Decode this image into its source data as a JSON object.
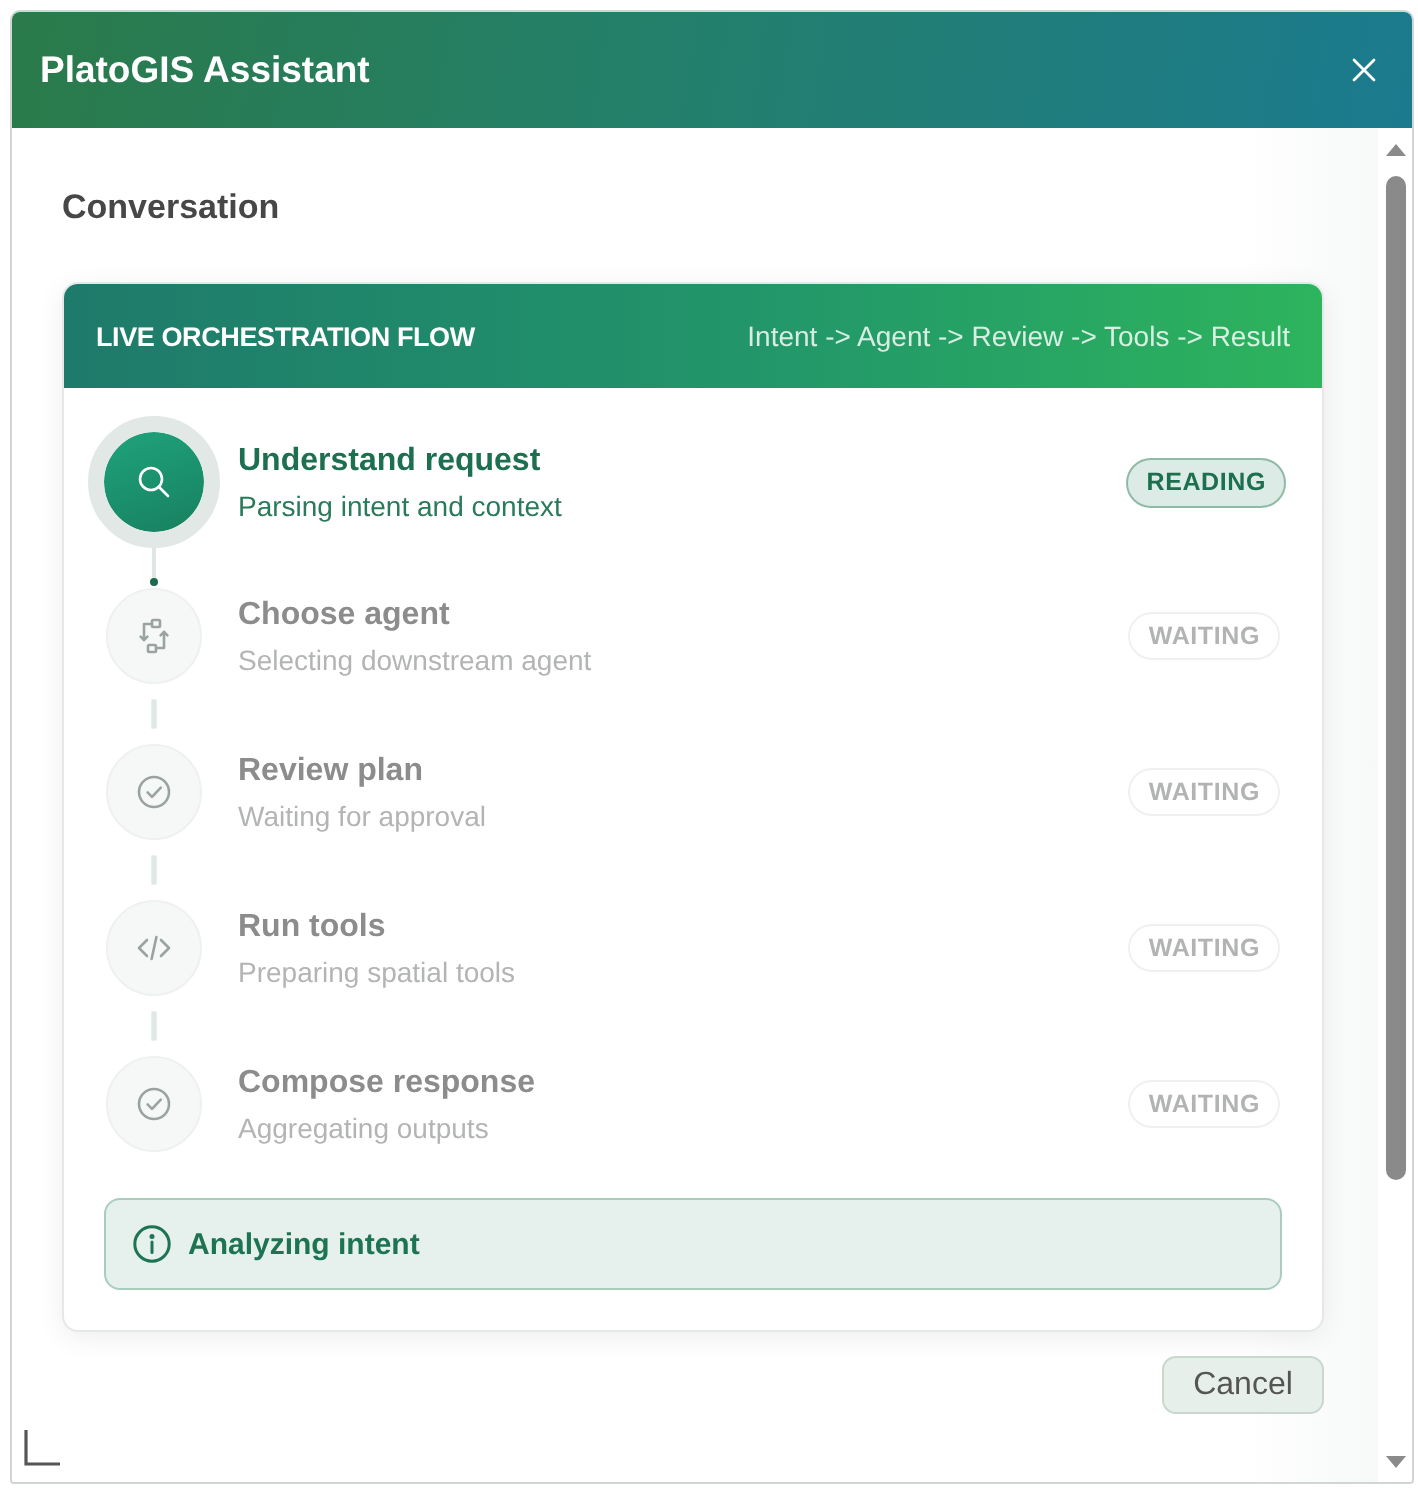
{
  "window": {
    "title": "PlatoGIS Assistant"
  },
  "conversation": {
    "heading": "Conversation"
  },
  "flow": {
    "title": "LIVE ORCHESTRATION FLOW",
    "pipeline": "Intent -> Agent -> Review -> Tools -> Result",
    "steps": [
      {
        "title": "Understand request",
        "detail": "Parsing intent and context",
        "badge": "READING",
        "active": true
      },
      {
        "title": "Choose agent",
        "detail": "Selecting downstream agent",
        "badge": "WAITING",
        "active": false
      },
      {
        "title": "Review plan",
        "detail": "Waiting for approval",
        "badge": "WAITING",
        "active": false
      },
      {
        "title": "Run tools",
        "detail": "Preparing spatial tools",
        "badge": "WAITING",
        "active": false
      },
      {
        "title": "Compose response",
        "detail": "Aggregating outputs",
        "badge": "WAITING",
        "active": false
      }
    ],
    "status": {
      "message": "Analyzing intent"
    }
  },
  "buttons": [
    {
      "label": "Cancel"
    }
  ]
}
